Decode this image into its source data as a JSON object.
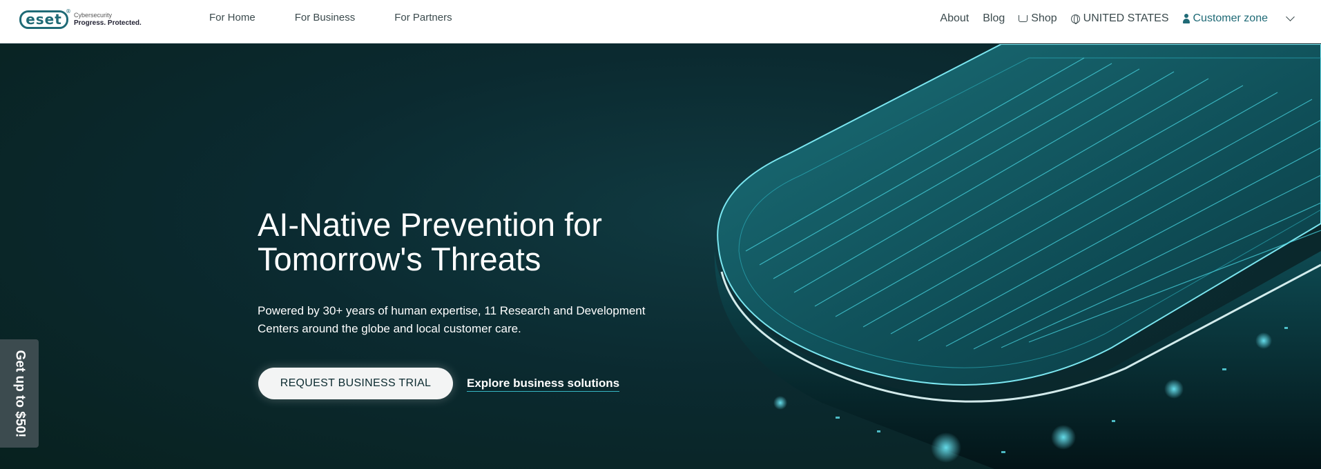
{
  "header": {
    "logo_mark": "eset",
    "logo_line1": "Cybersecurity",
    "logo_line2": "Progress. Protected.",
    "nav_left": [
      "For Home",
      "For Business",
      "For Partners"
    ],
    "nav_right": {
      "about": "About",
      "blog": "Blog",
      "shop": "Shop",
      "region": "UNITED STATES",
      "customer_zone": "Customer zone"
    }
  },
  "hero": {
    "title_line1": "AI-Native Prevention for",
    "title_line2": "Tomorrow's Threats",
    "desc_line1": "Powered by 30+ years of human expertise, 11 Research and Development",
    "desc_line2": "Centers around the globe and local customer care.",
    "cta_primary": "REQUEST BUSINESS TRIAL",
    "cta_secondary": "Explore business solutions"
  },
  "side_promo": "Get up to $50!",
  "colors": {
    "brand": "#1f6a76",
    "hero_bg": "#0c2b30",
    "glow": "#36b6c4"
  }
}
